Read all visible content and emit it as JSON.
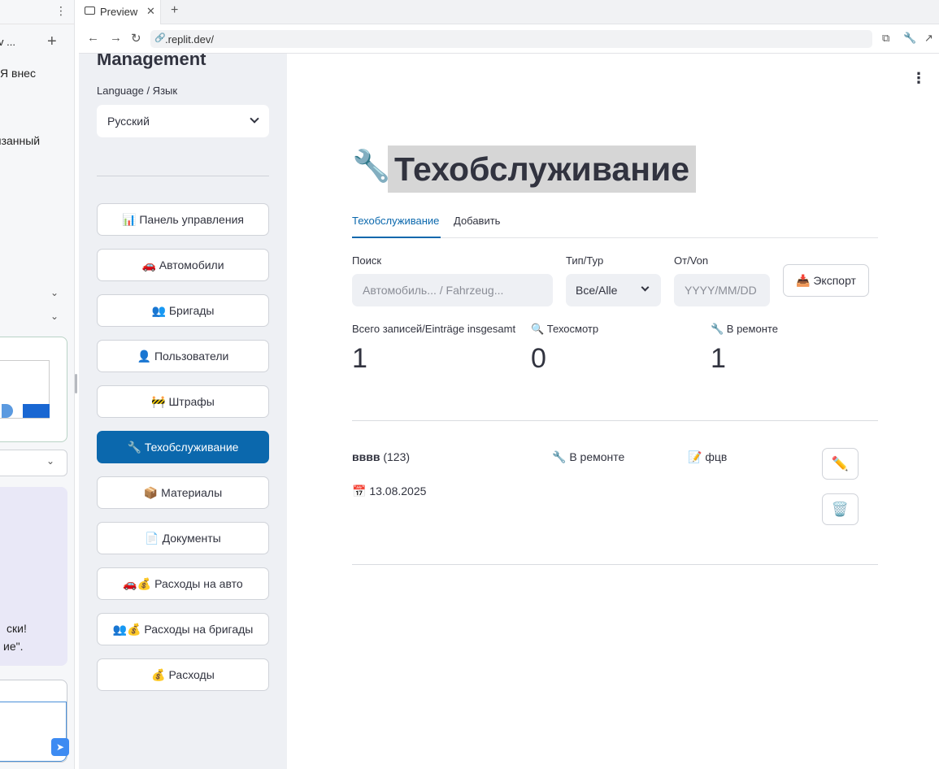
{
  "left_panel": {
    "tab_label": "v ...",
    "line1": "Я внес",
    "line2": "язанный",
    "msg_line1": "ски!",
    "msg_line2": "ие\"."
  },
  "browser": {
    "tab_label": "Preview",
    "url": ".replit.dev/"
  },
  "sidebar": {
    "title": "Management",
    "language_label": "Language / Язык",
    "language_value": "Русский",
    "nav": [
      {
        "label": "📊 Панель управления",
        "active": false
      },
      {
        "label": "🚗 Автомобили",
        "active": false
      },
      {
        "label": "👥 Бригады",
        "active": false
      },
      {
        "label": "👤 Пользователи",
        "active": false
      },
      {
        "label": "🚧 Штрафы",
        "active": false
      },
      {
        "label": "🔧 Техобслуживание",
        "active": true
      },
      {
        "label": "📦 Материалы",
        "active": false
      },
      {
        "label": "📄 Документы",
        "active": false
      },
      {
        "label": "🚗💰 Расходы на авто",
        "active": false
      },
      {
        "label": "👥💰 Расходы на бригады",
        "active": false
      },
      {
        "label": "💰 Расходы",
        "active": false
      }
    ]
  },
  "main": {
    "title_icon": "🔧",
    "title": "Техобслуживание",
    "tabs": [
      "Техобслуживание",
      "Добавить"
    ],
    "filters": {
      "search_label": "Поиск",
      "search_placeholder": "Автомобиль... / Fahrzeug...",
      "type_label": "Тип/Typ",
      "type_value": "Все/Alle",
      "from_label": "От/Von",
      "from_placeholder": "YYYY/MM/DD",
      "export_label": "📥 Экспорт"
    },
    "metrics": [
      {
        "label": "Всего записей/Einträge insgesamt",
        "value": "1"
      },
      {
        "label": "🔍 Техосмотр",
        "value": "0"
      },
      {
        "label": "🔧 В ремонте",
        "value": "1"
      }
    ],
    "record": {
      "name": "вввв",
      "code": "(123)",
      "status": "🔧 В ремонте",
      "note": "📝 фцв",
      "date": "📅 13.08.2025",
      "edit_icon": "✏️",
      "delete_icon": "🗑️"
    }
  }
}
